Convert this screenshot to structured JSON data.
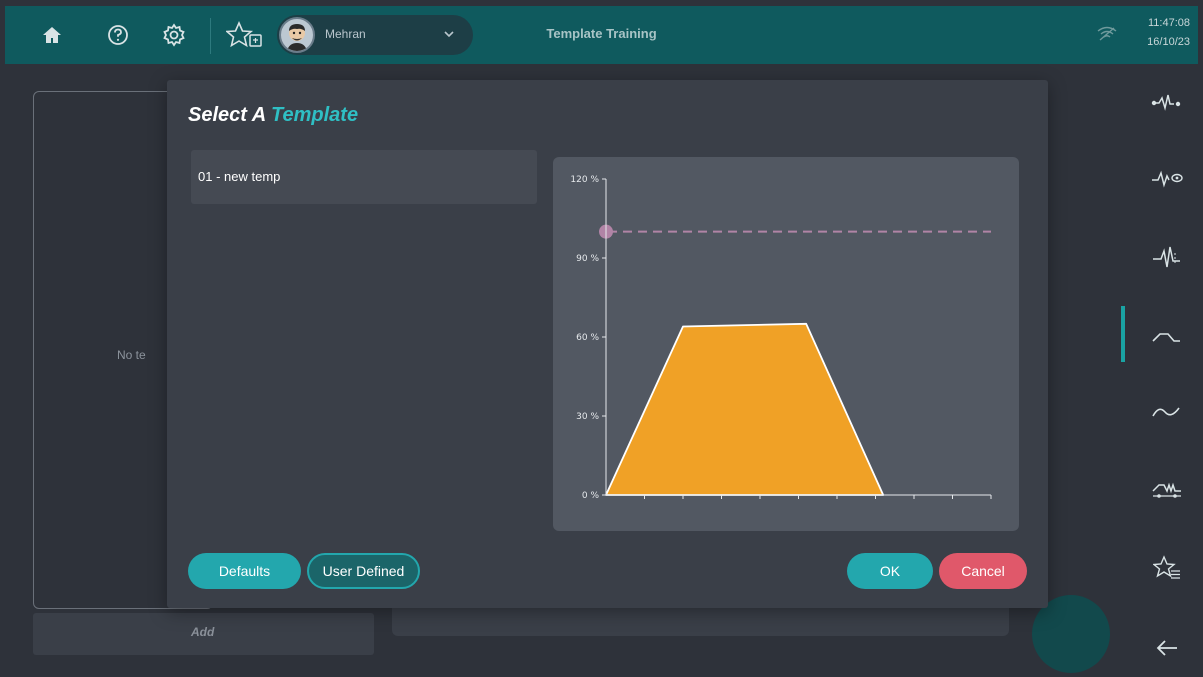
{
  "topbar": {
    "title": "Template Training",
    "user_name": "Mehran",
    "time": "11:47:08",
    "date": "16/10/23",
    "icons": [
      "home-icon",
      "help-icon",
      "gear-icon",
      "favorites-icon",
      "chevron-down-icon",
      "wifi-off-icon"
    ]
  },
  "rail": {
    "items": [
      "contraction-icon",
      "waveform-eye-icon",
      "spike-icon",
      "template-curve-icon",
      "sine-curve-icon",
      "train-icon",
      "favorites-list-icon",
      "back-arrow-icon"
    ]
  },
  "background": {
    "empty_text": "No te",
    "add_label": "Add"
  },
  "modal": {
    "title_part1": "Select A ",
    "title_part2": "Template",
    "templates": [
      {
        "label": "01 - new temp"
      }
    ],
    "buttons": {
      "defaults": "Defaults",
      "user_defined": "User Defined",
      "ok": "OK",
      "cancel": "Cancel"
    }
  },
  "colors": {
    "accent": "#23a7ad",
    "cancel": "#e0586a",
    "fill": "#f0a126",
    "threshold": "#b184a6"
  },
  "chart_data": {
    "type": "area",
    "title": "",
    "xlabel": "",
    "ylabel": "",
    "ylim": [
      0,
      120
    ],
    "yticks": [
      "0 %",
      "30 %",
      "60 %",
      "90 %",
      "120 %"
    ],
    "ytick_values": [
      0,
      30,
      60,
      90,
      120
    ],
    "x_tick_count": 10,
    "xlim": [
      0,
      10
    ],
    "x": [
      0,
      2,
      5.2,
      7.2
    ],
    "y": [
      0,
      64,
      65,
      0
    ],
    "threshold": 100,
    "grid": false,
    "legend": "none"
  }
}
